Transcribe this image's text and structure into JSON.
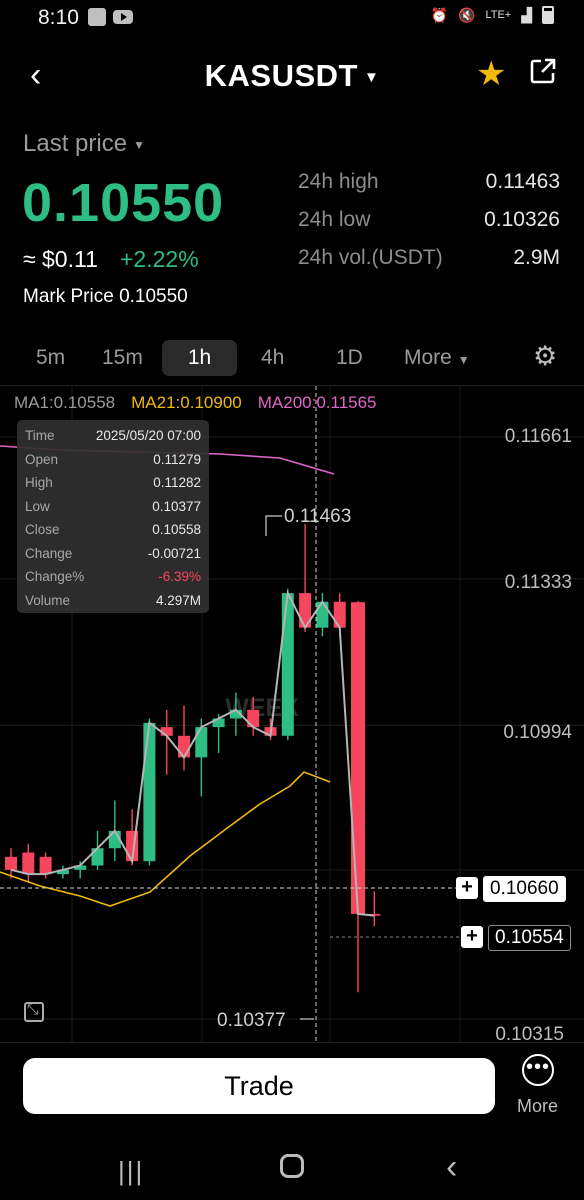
{
  "status_bar": {
    "time": "8:10",
    "network": "LTE+"
  },
  "header": {
    "symbol": "KASUSDT"
  },
  "price": {
    "label": "Last price",
    "last": "0.10550",
    "approx": "≈ $0.11",
    "change": "+2.22%",
    "mark_price": "Mark Price 0.10550"
  },
  "stats": [
    {
      "label": "24h high",
      "value": "0.11463"
    },
    {
      "label": "24h low",
      "value": "0.10326"
    },
    {
      "label": "24h vol.(USDT)",
      "value": "2.9M"
    }
  ],
  "intervals": [
    "5m",
    "15m",
    "1h",
    "4h",
    "1D",
    "More"
  ],
  "active_interval": "1h",
  "indicators": [
    {
      "text": "MA1:0.10558",
      "color": "#9a9a9a"
    },
    {
      "text": "MA21:0.10900",
      "color": "#f0b90b"
    },
    {
      "text": "MA200:0.11565",
      "color": "#e066c8"
    }
  ],
  "tooltip": [
    {
      "k": "Time",
      "v": "2025/05/20 07:00"
    },
    {
      "k": "Open",
      "v": "0.11279"
    },
    {
      "k": "High",
      "v": "0.11282"
    },
    {
      "k": "Low",
      "v": "0.10377"
    },
    {
      "k": "Close",
      "v": "0.10558"
    },
    {
      "k": "Change",
      "v": "-0.00721"
    },
    {
      "k": "Change%",
      "v": "-6.39%"
    },
    {
      "k": "Volume",
      "v": "4.297M"
    }
  ],
  "y_axis": [
    "0.11661",
    "0.11333",
    "0.10994",
    "0.10315"
  ],
  "chart_labels": {
    "high": "0.11463",
    "low": "0.10377",
    "crosshair_price": "0.10660",
    "current_price": "0.10554",
    "watermark": "WEEX"
  },
  "colors": {
    "up": "#2ebd85",
    "down": "#f6465d",
    "accent": "#f0b90b"
  },
  "bottom": {
    "trade": "Trade",
    "more": "More"
  }
}
